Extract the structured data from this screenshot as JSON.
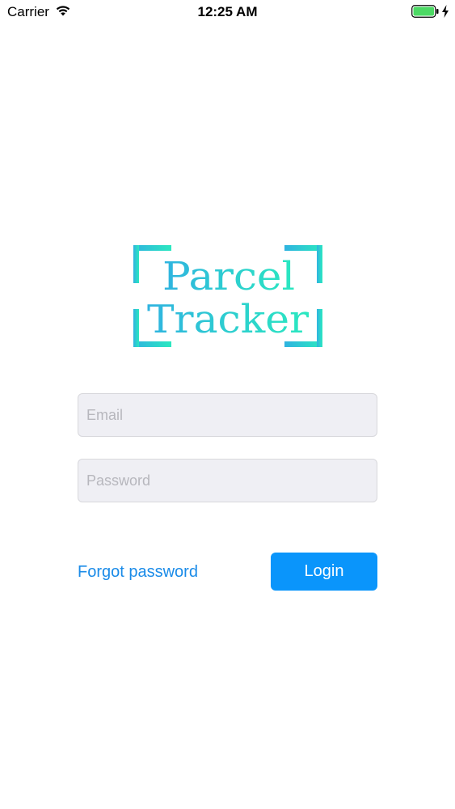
{
  "status_bar": {
    "carrier": "Carrier",
    "time": "12:25 AM",
    "icons": [
      "wifi-icon",
      "battery-icon",
      "charging-bolt-icon"
    ]
  },
  "logo": {
    "line1": "Parcel",
    "line2": "Tracker",
    "gradient_start": "#2fb3e0",
    "gradient_end": "#2be8c0"
  },
  "form": {
    "email_placeholder": "Email",
    "email_value": "",
    "password_placeholder": "Password",
    "password_value": "",
    "forgot_password_label": "Forgot password",
    "login_label": "Login"
  },
  "colors": {
    "accent": "#0a95fb",
    "link": "#1a8be8",
    "field_background": "#efeff4",
    "battery": "#4cd964"
  }
}
